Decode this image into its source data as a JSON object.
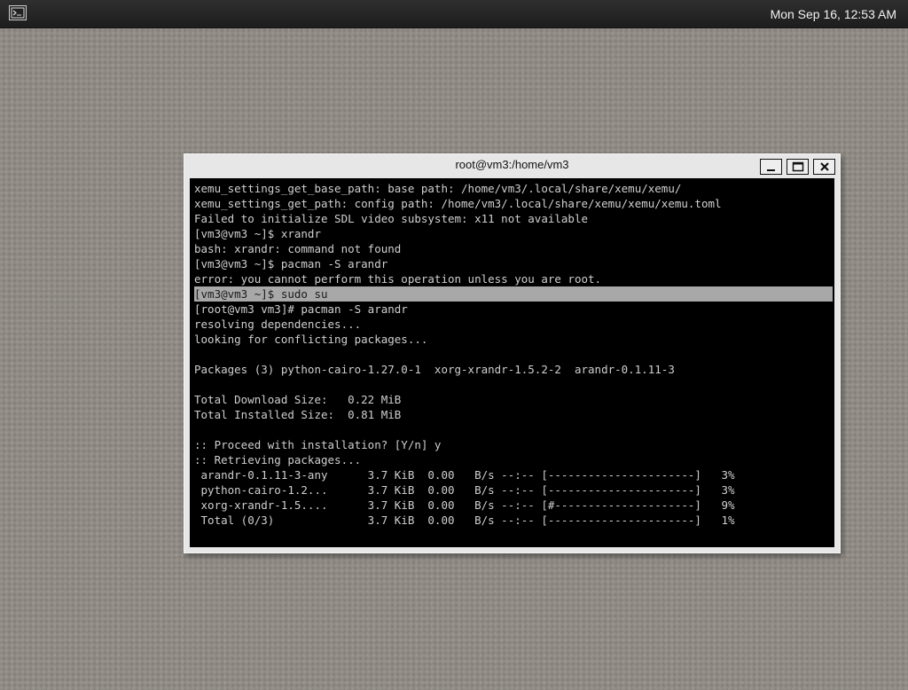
{
  "taskbar": {
    "menu_icon": "window-list-icon",
    "clock": "Mon Sep 16, 12:53 AM"
  },
  "window": {
    "title": "root@vm3:/home/vm3",
    "buttons": {
      "minimize_icon": "minimize-icon",
      "maximize_icon": "maximize-icon",
      "close_icon": "close-icon"
    }
  },
  "terminal": {
    "highlight_line": 7,
    "lines": [
      "xemu_settings_get_base_path: base path: /home/vm3/.local/share/xemu/xemu/",
      "xemu_settings_get_path: config path: /home/vm3/.local/share/xemu/xemu/xemu.toml",
      "Failed to initialize SDL video subsystem: x11 not available",
      "[vm3@vm3 ~]$ xrandr",
      "bash: xrandr: command not found",
      "[vm3@vm3 ~]$ pacman -S arandr",
      "error: you cannot perform this operation unless you are root.",
      "[vm3@vm3 ~]$ sudo su",
      "[root@vm3 vm3]# pacman -S arandr",
      "resolving dependencies...",
      "looking for conflicting packages...",
      "",
      "Packages (3) python-cairo-1.27.0-1  xorg-xrandr-1.5.2-2  arandr-0.1.11-3",
      "",
      "Total Download Size:   0.22 MiB",
      "Total Installed Size:  0.81 MiB",
      "",
      ":: Proceed with installation? [Y/n] y",
      ":: Retrieving packages...",
      " arandr-0.1.11-3-any      3.7 KiB  0.00   B/s --:-- [----------------------]   3%",
      " python-cairo-1.2...      3.7 KiB  0.00   B/s --:-- [----------------------]   3%",
      " xorg-xrandr-1.5....      3.7 KiB  0.00   B/s --:-- [#---------------------]   9%",
      " Total (0/3)              3.7 KiB  0.00   B/s --:-- [----------------------]   1%"
    ]
  }
}
